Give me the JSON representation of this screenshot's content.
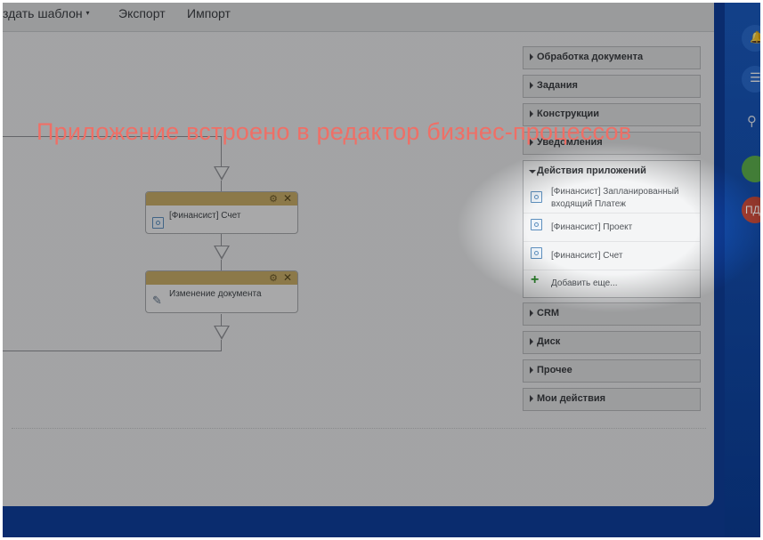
{
  "toolbar": {
    "create_template_label": "здать шаблон",
    "export_label": "Экспорт",
    "import_label": "Импорт"
  },
  "canvas": {
    "blocks": [
      {
        "label": "[Финансист] Счет"
      },
      {
        "label": "Изменение документа"
      }
    ]
  },
  "panel": {
    "sections_top": [
      {
        "label": "Обработка документа"
      },
      {
        "label": "Задания"
      },
      {
        "label": "Конструкции"
      },
      {
        "label": "Уведомления"
      }
    ],
    "app_actions": {
      "label": "Действия приложений",
      "items": [
        {
          "label": "[Финансист] Запланированный входящий Платеж"
        },
        {
          "label": "[Финансист] Проект"
        },
        {
          "label": "[Финансист] Счет"
        }
      ],
      "add_more": "Добавить еще..."
    },
    "sections_bottom": [
      {
        "label": "CRM"
      },
      {
        "label": "Диск"
      },
      {
        "label": "Прочее"
      },
      {
        "label": "Мои действия"
      }
    ]
  },
  "caption": "Приложение встроено в редактор бизнес-процессов",
  "sidebar_right": {
    "avatar_initials": "ПД"
  },
  "colors": {
    "caption": "#ef6f66",
    "block_header": "#c8ad68",
    "background_blue": "#0f3f9e"
  }
}
